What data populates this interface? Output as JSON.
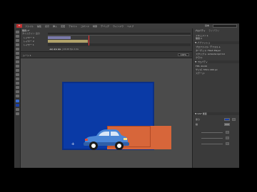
{
  "app": {
    "logo": "Fl",
    "menu": [
      "ファイル",
      "編集",
      "表示",
      "挿入",
      "変更",
      "テキスト",
      "コマンド",
      "制御",
      "デバッグ",
      "ウィンドウ",
      "ヘルプ"
    ],
    "workspace": "基本",
    "search_placeholder": ""
  },
  "timeline": {
    "document_tab": "無題-1*",
    "tabs": "タイムライン  出力",
    "layers": [
      "レイヤー 3",
      "レイヤー 2",
      "レイヤー 1"
    ],
    "controls": "◀◀  ◀  ▶  ▶▶  |  24.00 fps  1.0s"
  },
  "stage_bar": {
    "scene": "シーン 1",
    "zoom": "100%"
  },
  "properties": {
    "tab_properties": "プロパティ",
    "tab_library": "ライブラリ",
    "doc_label": "ドキュメント",
    "doc_name": "無題-1",
    "publish_header": "▼ パブリッシュ",
    "profile": "プロファイル: デフォルト",
    "target": "ターゲット: Flash Player",
    "script": "スクリプト: ActionScript 3.0",
    "class_label": "クラス:",
    "properties_header": "▼ プロパティ",
    "fps": "FPS: 24.00",
    "size": "サイズ: 550 x 400 px",
    "stage_label": "ステージ:",
    "history_header": "▼ SWF 履歴",
    "fill_label": "塗り",
    "stroke_label": "線"
  },
  "colors": {
    "stage": "#0a3aa6",
    "shape": "#d7663a",
    "car_body": "#4a86d6",
    "window": "#d9e7f7"
  }
}
